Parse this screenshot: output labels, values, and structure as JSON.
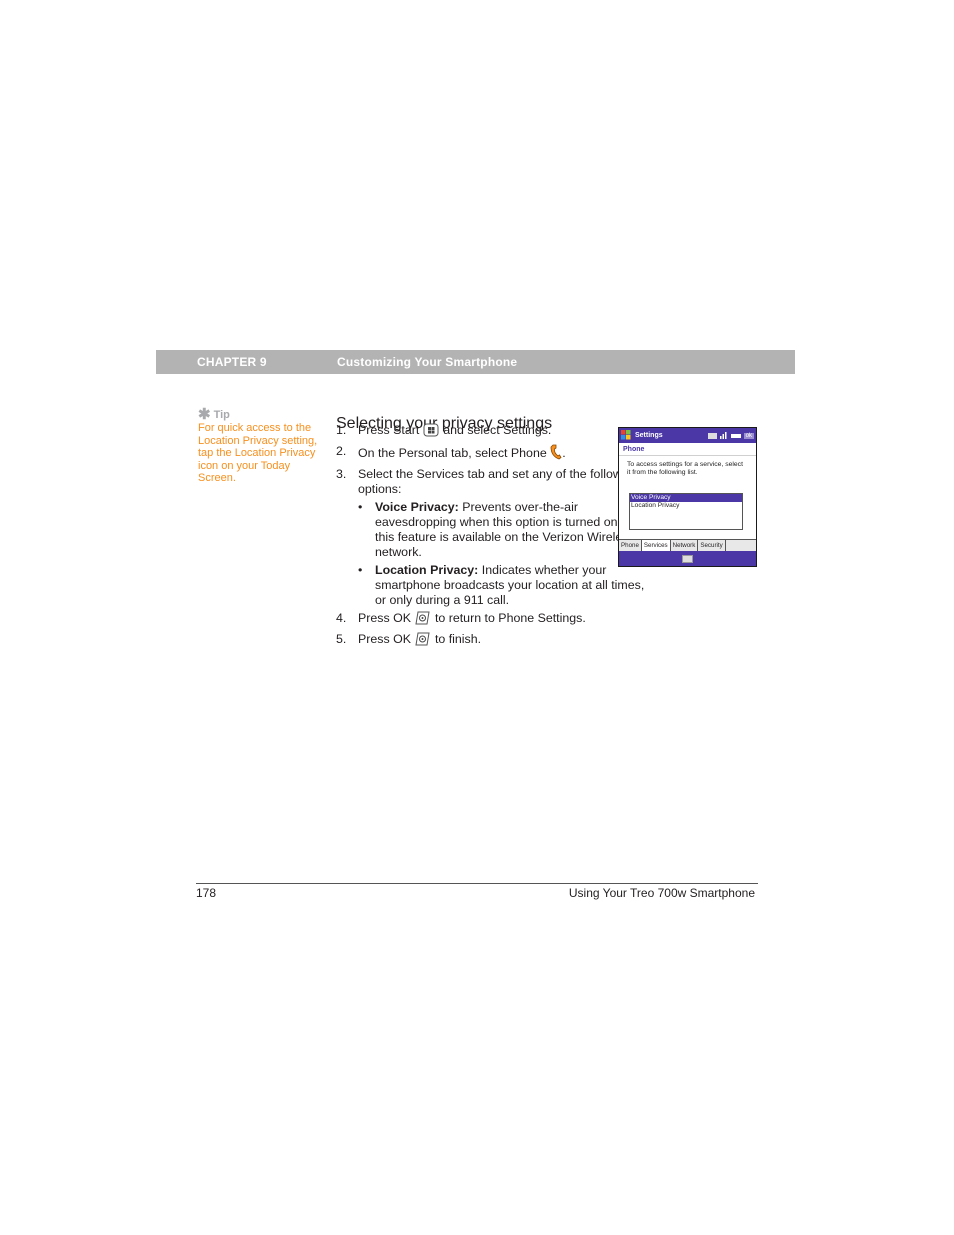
{
  "header": {
    "chapter": "CHAPTER 9",
    "title": "Customizing Your Smartphone"
  },
  "tip": {
    "label": "Tip",
    "icon": "asterisk-icon",
    "text": "For quick access to the Location Privacy setting, tap the Location Privacy icon on your Today Screen."
  },
  "section": {
    "heading": "Selecting your privacy settings",
    "steps": [
      {
        "num": "1.",
        "before": "Press Start",
        "icon": "windows-start-icon",
        "after": "and select Settings."
      },
      {
        "num": "2.",
        "before": "On the Personal tab, select Phone",
        "icon": "phone-icon",
        "after": "."
      },
      {
        "num": "3.",
        "text": "Select the Services tab and set any of the following options:"
      },
      {
        "num": "4.",
        "before": "Press OK",
        "icon": "ok-button-icon",
        "after": "to return to Phone Settings."
      },
      {
        "num": "5.",
        "before": "Press OK",
        "icon": "ok-button-icon",
        "after": "to finish."
      }
    ],
    "bullets": [
      {
        "term": "Voice Privacy:",
        "text": "Prevents over-the-air eavesdropping when this option is turned on and this feature is available on the Verizon Wireless network."
      },
      {
        "term": "Location Privacy:",
        "text": "Indicates whether your smartphone broadcasts your location at all times, or only during a 911 call."
      }
    ],
    "bullet_char": "•"
  },
  "screenshot": {
    "title": "Settings",
    "ok_label": "ok",
    "page_title": "Phone",
    "description": "To access settings for a service, select it from the following list.",
    "list_items": [
      "Voice Privacy",
      "Location Privacy"
    ],
    "selected_item": "Voice Privacy",
    "tabs": [
      "Phone",
      "Services",
      "Network",
      "Security"
    ],
    "active_tab": "Services",
    "colors": {
      "titlebar": "#4b37a6"
    }
  },
  "footer": {
    "page_number": "178",
    "book_title": "Using Your Treo 700w Smartphone"
  },
  "colors": {
    "tip_text": "#f7901e",
    "chapter_bar": "#b3b3b3"
  }
}
